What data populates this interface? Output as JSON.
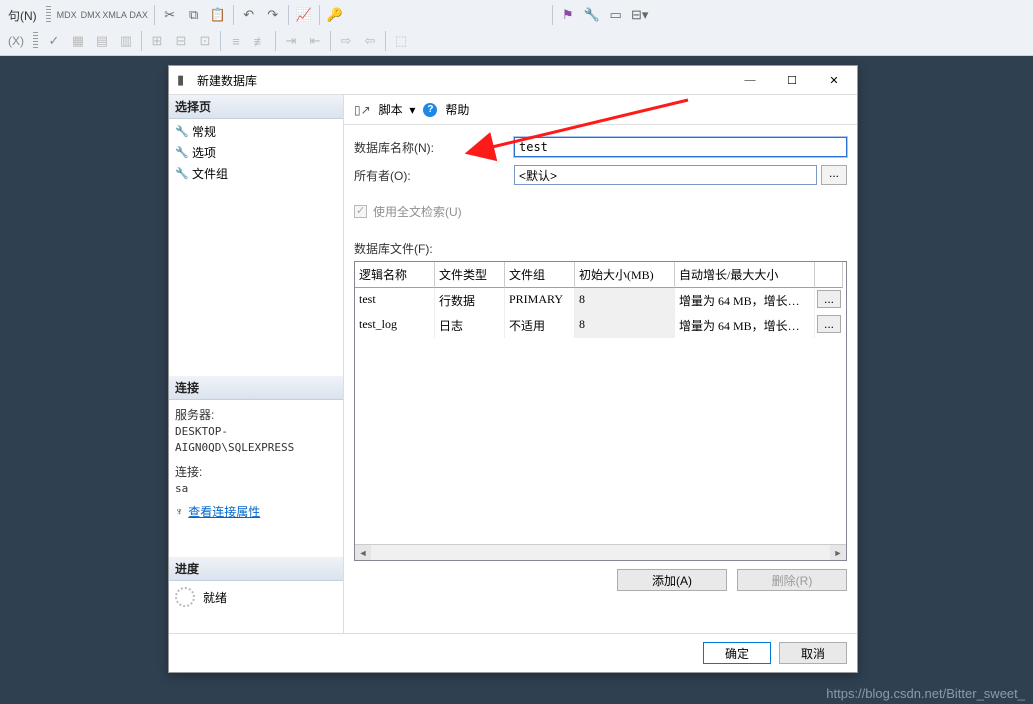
{
  "toolbar": {
    "menu_item": "句(N)",
    "icons_row1": [
      "MDX",
      "DMX",
      "XMLA",
      "DAX"
    ]
  },
  "dialog": {
    "title": "新建数据库",
    "window_buttons": {
      "min": "—",
      "max": "☐",
      "close": "✕"
    },
    "left": {
      "select_page_hdr": "选择页",
      "pages": [
        "常规",
        "选项",
        "文件组"
      ],
      "connection_hdr": "连接",
      "server_label": "服务器:",
      "server_value": "DESKTOP-AIGN0QD\\SQLEXPRESS",
      "conn_label": "连接:",
      "conn_value": "sa",
      "view_props": "查看连接属性",
      "progress_hdr": "进度",
      "progress_status": "就绪"
    },
    "right": {
      "script_label": "脚本",
      "script_arrow": "▾",
      "help_label": "帮助",
      "db_name_label": "数据库名称(N):",
      "db_name_value": "test",
      "owner_label": "所有者(O):",
      "owner_value": "<默认>",
      "browse_btn": "...",
      "fulltext_label": "使用全文检索(U)",
      "files_label": "数据库文件(F):",
      "grid": {
        "headers": [
          "逻辑名称",
          "文件类型",
          "文件组",
          "初始大小(MB)",
          "自动增长/最大大小",
          ""
        ],
        "rows": [
          {
            "name": "test",
            "type": "行数据",
            "group": "PRIMARY",
            "size": "8",
            "growth": "增量为 64 MB，增长…",
            "btn": "..."
          },
          {
            "name": "test_log",
            "type": "日志",
            "group": "不适用",
            "size": "8",
            "growth": "增量为 64 MB，增长…",
            "btn": "..."
          }
        ]
      },
      "add_btn": "添加(A)",
      "remove_btn": "删除(R)"
    },
    "footer": {
      "ok": "确定",
      "cancel": "取消"
    }
  },
  "watermark": "https://blog.csdn.net/Bitter_sweet_"
}
